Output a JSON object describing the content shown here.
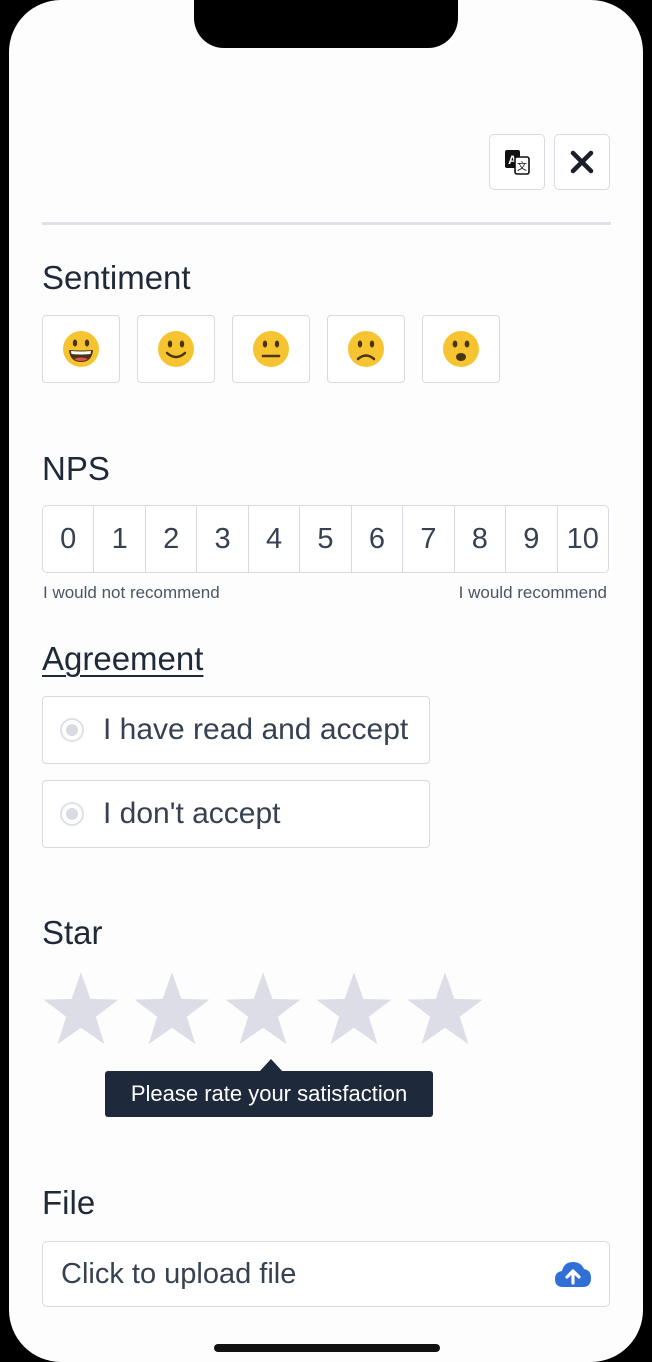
{
  "header": {
    "translate_icon": "translate-icon",
    "close_icon": "close-icon"
  },
  "sentiment": {
    "title": "Sentiment",
    "options": [
      {
        "icon": "grinning-face-icon"
      },
      {
        "icon": "slightly-smiling-face-icon"
      },
      {
        "icon": "neutral-face-icon"
      },
      {
        "icon": "slightly-frowning-face-icon"
      },
      {
        "icon": "frowning-face-icon"
      }
    ]
  },
  "nps": {
    "title": "NPS",
    "values": [
      "0",
      "1",
      "2",
      "3",
      "4",
      "5",
      "6",
      "7",
      "8",
      "9",
      "10"
    ],
    "low_label": "I would not recommend",
    "high_label": "I would recommend"
  },
  "agreement": {
    "title": "Agreement",
    "options": [
      "I have read and accept",
      "I don't accept"
    ]
  },
  "star": {
    "title": "Star",
    "max": 5,
    "rating": 0,
    "tooltip": "Please rate your satisfaction",
    "empty_color": "#dcdde6"
  },
  "file": {
    "title": "File",
    "placeholder": "Click to upload file",
    "icon": "cloud-upload-icon",
    "icon_color": "#2f6fd6"
  }
}
